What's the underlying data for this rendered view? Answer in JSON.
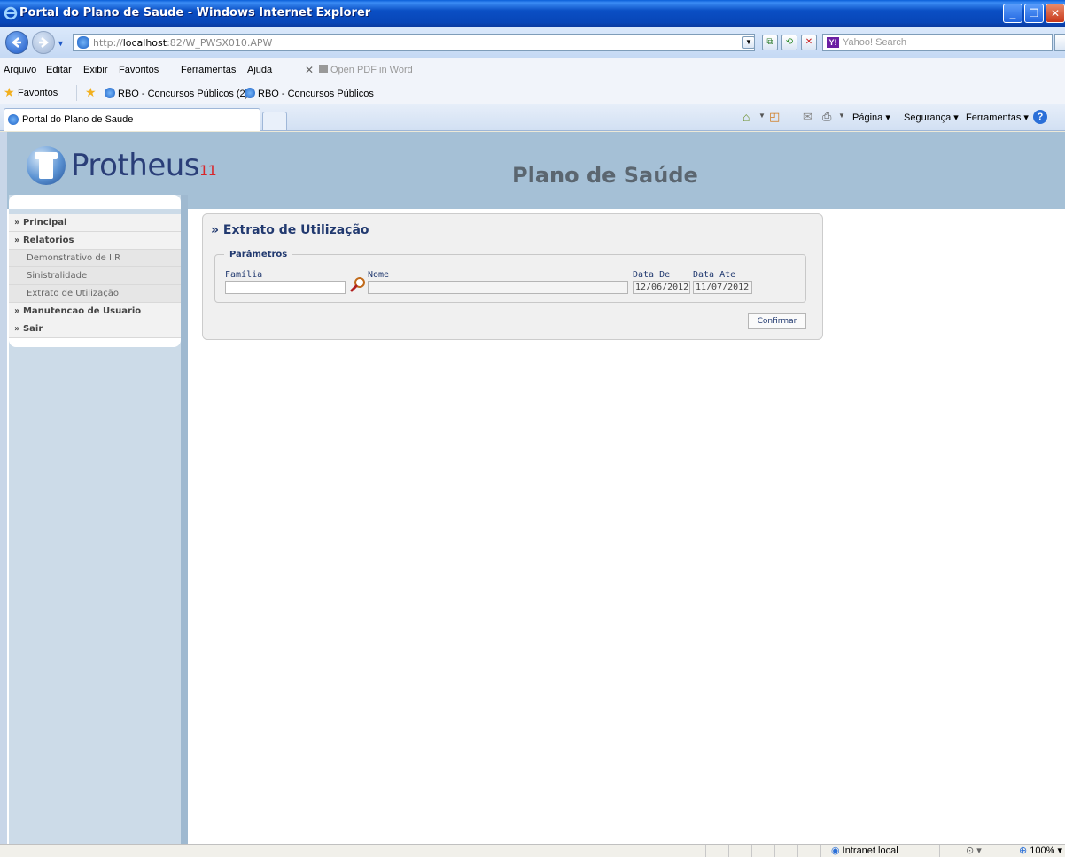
{
  "window": {
    "title": "Portal do Plano de Saude - Windows Internet Explorer"
  },
  "address_bar": {
    "url_prefix": "http://",
    "url_host": "localhost",
    "url_rest": ":82/W_PWSX010.APW",
    "search_placeholder": "Yahoo! Search",
    "search_badge": "Y!"
  },
  "menubar": {
    "items": [
      "Arquivo",
      "Editar",
      "Exibir",
      "Favoritos",
      "Ferramentas",
      "Ajuda"
    ],
    "addon_label": "Open PDF in Word"
  },
  "favorites": {
    "label": "Favoritos",
    "links": [
      "RBO - Concursos Públicos (2)",
      "RBO - Concursos Públicos"
    ]
  },
  "tabs": {
    "active": "Portal do Plano de Saude"
  },
  "commandbar": {
    "pagina": "Página",
    "seguranca": "Segurança",
    "ferramentas": "Ferramentas"
  },
  "header": {
    "logo_text": "Protheus",
    "logo_version": "11",
    "site_title": "Plano de Saúde"
  },
  "sidebar": {
    "items": [
      {
        "label": "» Principal",
        "type": "head"
      },
      {
        "label": "» Relatorios",
        "type": "head"
      },
      {
        "label": "Demonstrativo de I.R",
        "type": "sub"
      },
      {
        "label": "Sinistralidade",
        "type": "sub"
      },
      {
        "label": "Extrato de Utilização",
        "type": "sub"
      },
      {
        "label": "» Manutencao de Usuario",
        "type": "head"
      },
      {
        "label": "» Sair",
        "type": "head"
      }
    ]
  },
  "panel": {
    "title": "» Extrato de Utilização",
    "legend": "Parâmetros",
    "familia_label": "Família",
    "familia_value": "",
    "nome_label": "Nome",
    "nome_value": "",
    "data_de_label": "Data De",
    "data_de_value": "12/06/2012",
    "data_ate_label": "Data Ate",
    "data_ate_value": "11/07/2012",
    "confirm_label": "Confirmar"
  },
  "statusbar": {
    "zone": "Intranet local",
    "zoom": "100%"
  },
  "colors": {
    "header_bg": "#a5c0d6",
    "sidebar_bg": "#ccdbe8",
    "title_blue": "#223a70"
  }
}
